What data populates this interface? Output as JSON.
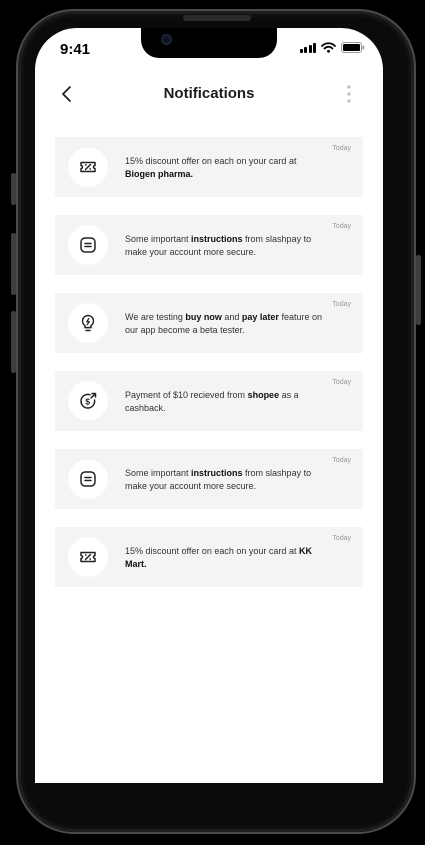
{
  "status_bar": {
    "time": "9:41"
  },
  "header": {
    "title": "Notifications"
  },
  "notifications": [
    {
      "icon": "discount-ticket-icon",
      "date": "Today",
      "parts": [
        "15% discount offer on each on your card at ",
        "Biogen pharma."
      ]
    },
    {
      "icon": "document-icon",
      "date": "Today",
      "parts": [
        "Some important ",
        "instructions",
        " from slashpay to make your account more secure."
      ]
    },
    {
      "icon": "lightbulb-icon",
      "date": "Today",
      "parts": [
        "We are testing ",
        "buy now",
        " and ",
        "pay later",
        " feature on our app become a beta tester."
      ]
    },
    {
      "icon": "cashback-icon",
      "date": "Today",
      "parts": [
        "Payment of $10 recieved from ",
        "shopee",
        " as a cashback."
      ]
    },
    {
      "icon": "document-icon",
      "date": "Today",
      "parts": [
        "Some important ",
        "instructions",
        " from slashpay to make your account more secure."
      ]
    },
    {
      "icon": "discount-ticket-icon",
      "date": "Today",
      "parts": [
        "15% discount offer on each on your card at ",
        "KK Mart."
      ]
    }
  ]
}
